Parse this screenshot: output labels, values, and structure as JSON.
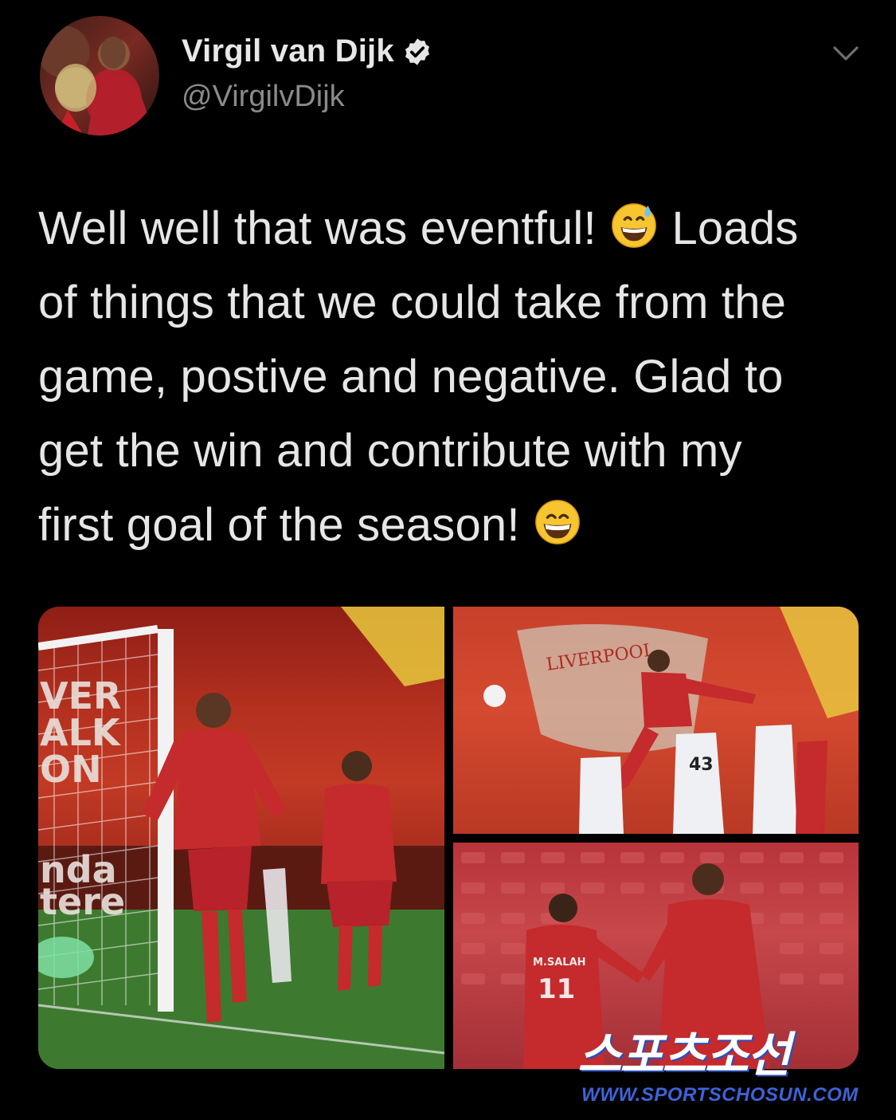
{
  "author": {
    "display_name": "Virgil van Dijk",
    "handle": "@VirgilvDijk",
    "verified_icon": "verified-badge-icon",
    "avatar_icon": "profile-avatar"
  },
  "menu": {
    "icon": "chevron-down-icon"
  },
  "tweet": {
    "line1_pre": "Well well that was eventful! ",
    "line1_post": " Loads",
    "line2": "of things that we could take from the",
    "line3": "game, postive and negative. Glad to",
    "line4": "get the win and contribute with my",
    "line5_pre": "first goal of the season! ",
    "emoji_1": "grinning-face-with-sweat-emoji",
    "emoji_2": "grinning-face-with-smiling-eyes-emoji"
  },
  "media": {
    "photo_left": "celebration-photo",
    "photo_top_right": "header-goal-photo",
    "photo_bottom_right": "fist-bump-photo",
    "jersey_number_43": "43",
    "jersey_name_salah": "M.SALAH",
    "jersey_number_11": "11",
    "crest_text": "LIVERPOOL"
  },
  "watermark": {
    "logo_text": "스포츠조선",
    "url": "WWW.SPORTSCHOSUN.COM"
  }
}
